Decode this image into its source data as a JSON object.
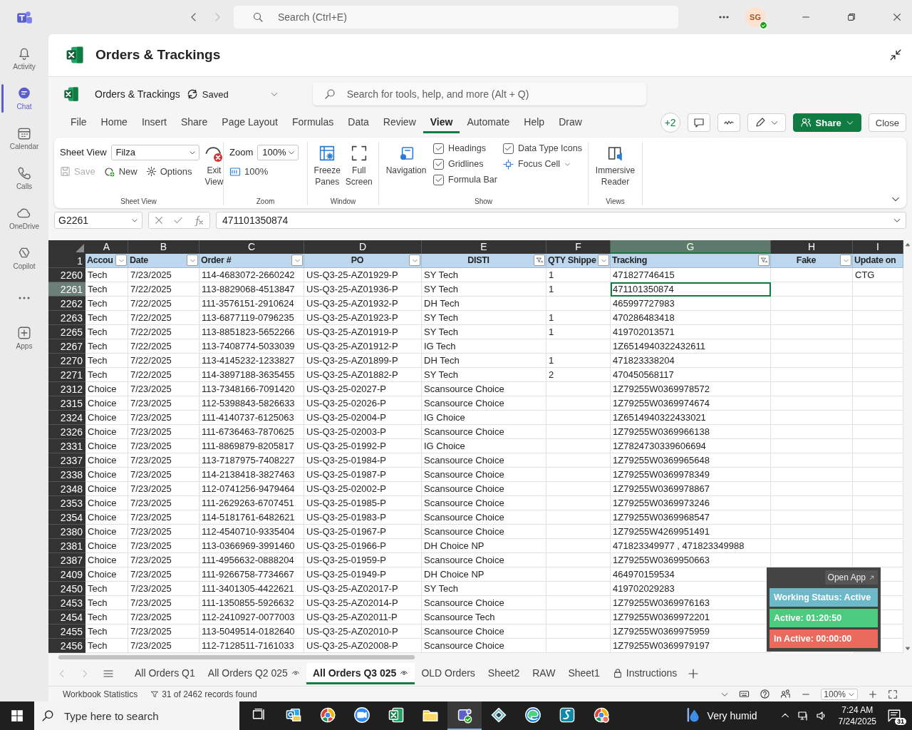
{
  "teams": {
    "search_placeholder": "Search (Ctrl+E)",
    "avatar": "SG"
  },
  "rail": [
    {
      "label": "Activity",
      "selected": false
    },
    {
      "label": "Chat",
      "selected": true
    },
    {
      "label": "Calendar",
      "selected": false
    },
    {
      "label": "Calls",
      "selected": false
    },
    {
      "label": "OneDrive",
      "selected": false
    },
    {
      "label": "Copilot",
      "selected": false
    },
    {
      "selected": false
    },
    {
      "label": "Apps",
      "selected": false
    }
  ],
  "app": {
    "title": "Orders & Trackings"
  },
  "doc": {
    "name": "Orders & Trackings",
    "status": "Saved",
    "search_placeholder": "Search for tools, help, and more (Alt + Q)"
  },
  "menu": [
    {
      "label": "File",
      "selected": false
    },
    {
      "label": "Home",
      "selected": false
    },
    {
      "label": "Insert",
      "selected": false
    },
    {
      "label": "Share",
      "selected": false
    },
    {
      "label": "Page Layout",
      "selected": false
    },
    {
      "label": "Formulas",
      "selected": false
    },
    {
      "label": "Data",
      "selected": false
    },
    {
      "label": "Review",
      "selected": false
    },
    {
      "label": "View",
      "selected": true
    },
    {
      "label": "Automate",
      "selected": false
    },
    {
      "label": "Help",
      "selected": false
    },
    {
      "label": "Draw",
      "selected": false
    }
  ],
  "toolbar": {
    "collaborators": "+2",
    "share": "Share",
    "close": "Close"
  },
  "ribbon": {
    "sheet_view": {
      "label": "Sheet View",
      "value": "Filza",
      "save": "Save",
      "save_disabled": true,
      "new": "New",
      "options": "Options",
      "exit": "Exit View",
      "group": "Sheet View"
    },
    "zoom": {
      "label": "Zoom",
      "value": "100%",
      "reset": "100%",
      "group": "Zoom"
    },
    "window": {
      "freeze": "Freeze Panes",
      "full": "Full Screen",
      "group": "Window"
    },
    "show": {
      "navigation": "Navigation",
      "checks": [
        {
          "label": "Headings",
          "checked": true
        },
        {
          "label": "Gridlines",
          "checked": true
        },
        {
          "label": "Formula Bar",
          "checked": true
        },
        {
          "label": "Data Type Icons",
          "checked": true
        }
      ],
      "focus_cell": "Focus Cell",
      "group": "Show"
    },
    "views": {
      "reader": "Immersive Reader",
      "group": "Views"
    }
  },
  "formula_bar": {
    "name_box": "G2261",
    "value": "471101350874"
  },
  "header_row": "1",
  "columns": [
    {
      "letter": "A",
      "header": "Accou",
      "kind": "dropdown",
      "selected": false
    },
    {
      "letter": "B",
      "header": "Date",
      "kind": "dropdown",
      "selected": false
    },
    {
      "letter": "C",
      "header": "Order #",
      "kind": "dropdown",
      "selected": false
    },
    {
      "letter": "D",
      "header": "PO",
      "kind": "dropdown",
      "selected": false
    },
    {
      "letter": "E",
      "header": "DISTI",
      "kind": "filtered",
      "selected": false
    },
    {
      "letter": "F",
      "header": "QTY Shippe",
      "kind": "dropdown",
      "selected": false
    },
    {
      "letter": "G",
      "header": "Tracking",
      "kind": "filtered",
      "selected": true
    },
    {
      "letter": "H",
      "header": "Fake",
      "kind": "dropdown",
      "selected": false
    },
    {
      "letter": "I",
      "header": "Update on",
      "kind": "plain",
      "selected": false
    }
  ],
  "rows": [
    {
      "num": "2260",
      "selected": false,
      "cells": [
        "Tech",
        "7/23/2025",
        "114-4683072-2660242",
        "US-Q3-25-AZ01929-P",
        "SY Tech",
        "1",
        "471827746415",
        null,
        "CTG"
      ]
    },
    {
      "num": "2261",
      "selected": true,
      "cells": [
        "Tech",
        "7/22/2025",
        "113-8829068-4513847",
        "US-Q3-25-AZ01936-P",
        "SY Tech",
        "1",
        "471101350874",
        null,
        null
      ]
    },
    {
      "num": "2262",
      "selected": false,
      "cells": [
        "Tech",
        "7/22/2025",
        "111-3576151-2910624",
        "US-Q3-25-AZ01932-P",
        "DH Tech",
        null,
        "465997727983",
        null,
        null
      ]
    },
    {
      "num": "2263",
      "selected": false,
      "cells": [
        "Tech",
        "7/22/2025",
        "113-6877119-0796235",
        "US-Q3-25-AZ01923-P",
        "SY Tech",
        "1",
        "470286483418",
        null,
        null
      ]
    },
    {
      "num": "2265",
      "selected": false,
      "cells": [
        "Tech",
        "7/22/2025",
        "113-8851823-5652266",
        "US-Q3-25-AZ01919-P",
        "SY Tech",
        "1",
        "419702013571",
        null,
        null
      ]
    },
    {
      "num": "2267",
      "selected": false,
      "cells": [
        "Tech",
        "7/22/2025",
        "113-7408774-5033039",
        "US-Q3-25-AZ01912-P",
        "IG Tech",
        null,
        "1Z6514940322432611",
        null,
        null
      ]
    },
    {
      "num": "2270",
      "selected": false,
      "cells": [
        "Tech",
        "7/22/2025",
        "113-4145232-1233827",
        "US-Q3-25-AZ01899-P",
        "DH Tech",
        "1",
        "471823338204",
        null,
        null
      ]
    },
    {
      "num": "2271",
      "selected": false,
      "cells": [
        "Tech",
        "7/22/2025",
        "114-3897188-3635455",
        "US-Q3-25-AZ01882-P",
        "SY Tech",
        "2",
        "470450568117",
        null,
        null
      ]
    },
    {
      "num": "2312",
      "selected": false,
      "cells": [
        "Choice",
        "7/23/2025",
        "113-7348166-7091420",
        "US-Q3-25-02027-P",
        "Scansource Choice",
        null,
        "1Z79255W0369978572",
        null,
        null
      ]
    },
    {
      "num": "2315",
      "selected": false,
      "cells": [
        "Choice",
        "7/23/2025",
        "112-5398843-5826633",
        "US-Q3-25-02026-P",
        "Scansource Choice",
        null,
        "1Z79255W0369974674",
        null,
        null
      ]
    },
    {
      "num": "2324",
      "selected": false,
      "cells": [
        "Choice",
        "7/23/2025",
        "111-4140737-6125063",
        "US-Q3-25-02004-P",
        "IG Choice",
        null,
        "1Z6514940322433021",
        null,
        null
      ]
    },
    {
      "num": "2326",
      "selected": false,
      "cells": [
        "Choice",
        "7/23/2025",
        "111-6736463-7870625",
        "US-Q3-25-02003-P",
        "Scansource Choice",
        null,
        "1Z79255W0369966138",
        null,
        null
      ]
    },
    {
      "num": "2331",
      "selected": false,
      "cells": [
        "Choice",
        "7/23/2025",
        "111-8869879-8205817",
        "US-Q3-25-01992-P",
        "IG Choice",
        null,
        "1Z7824730339606694",
        null,
        null
      ]
    },
    {
      "num": "2337",
      "selected": false,
      "cells": [
        "Choice",
        "7/23/2025",
        "113-7187975-7408227",
        "US-Q3-25-01984-P",
        "Scansource Choice",
        null,
        "1Z79255W0369965648",
        null,
        null
      ]
    },
    {
      "num": "2338",
      "selected": false,
      "cells": [
        "Choice",
        "7/23/2025",
        "114-2138418-3827463",
        "US-Q3-25-01987-P",
        "Scansource Choice",
        null,
        "1Z79255W0369978349",
        null,
        null
      ]
    },
    {
      "num": "2348",
      "selected": false,
      "cells": [
        "Choice",
        "7/23/2025",
        "112-0741256-9479464",
        "US-Q3-25-02002-P",
        "Scansource Choice",
        null,
        "1Z79255W0369978867",
        null,
        null
      ]
    },
    {
      "num": "2353",
      "selected": false,
      "cells": [
        "Choice",
        "7/23/2025",
        "111-2629263-6707451",
        "US-Q3-25-01985-P",
        "Scansource Choice",
        null,
        "1Z79255W0369973246",
        null,
        null
      ]
    },
    {
      "num": "2354",
      "selected": false,
      "cells": [
        "Choice",
        "7/23/2025",
        "114-5181761-6482621",
        "US-Q3-25-01983-P",
        "Scansource Choice",
        null,
        "1Z79255W0369968547",
        null,
        null
      ]
    },
    {
      "num": "2380",
      "selected": false,
      "cells": [
        "Choice",
        "7/23/2025",
        "112-4540710-9335404",
        "US-Q3-25-01967-P",
        "Scansource Choice",
        null,
        "1Z79255W4269951491",
        null,
        null
      ]
    },
    {
      "num": "2381",
      "selected": false,
      "cells": [
        "Choice",
        "7/23/2025",
        "113-0366969-3991460",
        "US-Q3-25-01966-P",
        "DH Choice NP",
        null,
        "471823349977 , 471823349988",
        null,
        null
      ]
    },
    {
      "num": "2387",
      "selected": false,
      "cells": [
        "Choice",
        "7/23/2025",
        "111-4956632-0888204",
        "US-Q3-25-01959-P",
        "Scansource Choice",
        null,
        "1Z79255W0369950663",
        null,
        null
      ]
    },
    {
      "num": "2409",
      "selected": false,
      "cells": [
        "Choice",
        "7/23/2025",
        "111-9266758-7734667",
        "US-Q3-25-01949-P",
        "DH Choice NP",
        null,
        "464970159534",
        null,
        null
      ]
    },
    {
      "num": "2450",
      "selected": false,
      "cells": [
        "Tech",
        "7/23/2025",
        "111-3401305-4422621",
        "US-Q3-25-AZ02017-P",
        "SY Tech",
        null,
        "419702029283",
        null,
        null
      ]
    },
    {
      "num": "2453",
      "selected": false,
      "cells": [
        "Tech",
        "7/23/2025",
        "111-1350855-5926632",
        "US-Q3-25-AZ02014-P",
        "Scansource Choice",
        null,
        "1Z79255W0369976163",
        null,
        null
      ]
    },
    {
      "num": "2454",
      "selected": false,
      "cells": [
        "Tech",
        "7/23/2025",
        "112-2410927-0077003",
        "US-Q3-25-AZ02011-P",
        "Scansource Tech",
        null,
        "1Z79255W0369972201",
        null,
        null
      ]
    },
    {
      "num": "2455",
      "selected": false,
      "cells": [
        "Tech",
        "7/23/2025",
        "113-5049514-0182640",
        "US-Q3-25-AZ02010-P",
        "Scansource Choice",
        null,
        "1Z79255W0369975959",
        null,
        null
      ]
    },
    {
      "num": "2456",
      "selected": false,
      "cells": [
        "Tech",
        "7/23/2025",
        "112-7128511-7161033",
        "US-Q3-25-AZ02008-P",
        "Scansource Choice",
        null,
        "1Z79255W0369979197",
        null,
        null
      ]
    }
  ],
  "widget": {
    "open_app": "Open App",
    "items": [
      {
        "text": "Working Status: Active",
        "color": "#6cb9c9"
      },
      {
        "text": "Active: 01:20:50",
        "color": "#4ccb7e"
      },
      {
        "text": "In Active: 00:00:00",
        "color": "#ea6a5e"
      }
    ]
  },
  "sheets": [
    {
      "label": "All Orders Q1",
      "kind": "plain",
      "selected": false
    },
    {
      "label": "All Orders Q2 025",
      "kind": "watched",
      "selected": false
    },
    {
      "label": "All Orders Q3 025",
      "kind": "watched",
      "selected": true
    },
    {
      "label": "OLD Orders",
      "kind": "plain",
      "selected": false
    },
    {
      "label": "Sheet2",
      "kind": "plain",
      "selected": false
    },
    {
      "label": "RAW",
      "kind": "plain",
      "selected": false
    },
    {
      "label": "Sheet1",
      "kind": "plain",
      "selected": false
    },
    {
      "label": "Instructions",
      "kind": "locked",
      "selected": false
    }
  ],
  "status_bar": {
    "statistics": "Workbook Statistics",
    "filter_info": "31 of 2462 records found",
    "zoom": "100%"
  },
  "taskbar": {
    "search_placeholder": "Type here to search",
    "apps": [
      {
        "active": false
      },
      {
        "active": false
      },
      {
        "active": false
      },
      {
        "active": false
      },
      {
        "active": false
      },
      {
        "active": false
      },
      {
        "active": true
      },
      {
        "active": false
      },
      {
        "active": false
      },
      {
        "active": false
      },
      {
        "active": false
      }
    ],
    "weather": "Very humid",
    "time": "7:24 AM",
    "date": "7/24/2025",
    "notifications": "31"
  }
}
